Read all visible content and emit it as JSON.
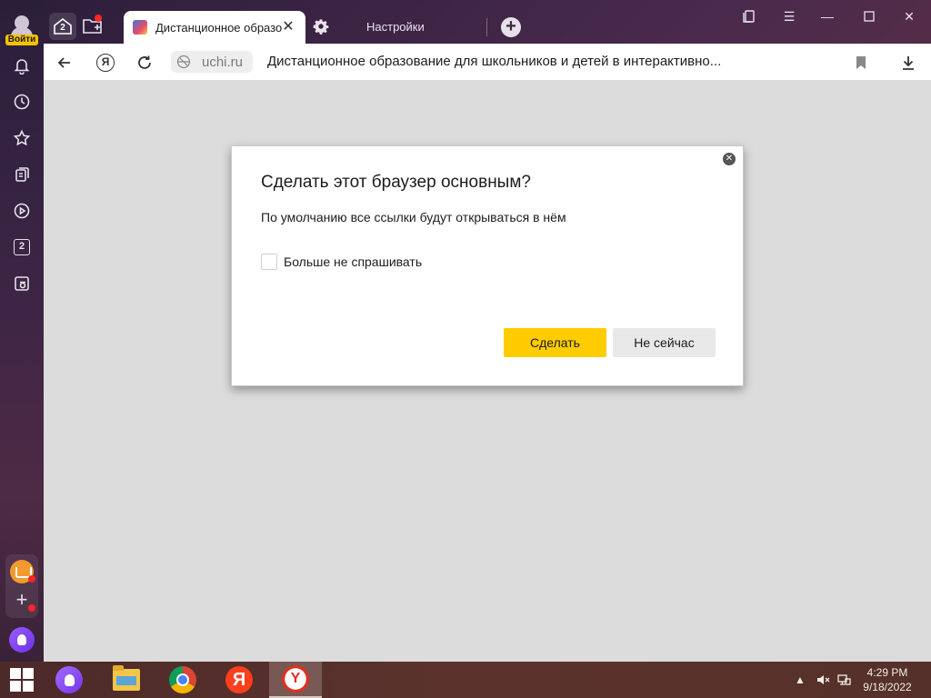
{
  "sidebar": {
    "login_label": "Войти",
    "counter_badge": "2"
  },
  "tabs": {
    "home_count": "2",
    "active_title": "Дистанционное образование для школьников",
    "settings_label": "Настройки"
  },
  "address_bar": {
    "domain": "uchi.ru",
    "page_title": "Дистанционное образование для школьников и детей в интерактивно..."
  },
  "dialog": {
    "title": "Сделать этот браузер основным?",
    "description": "По умолчанию все ссылки будут открываться в нём",
    "checkbox_label": "Больше не спрашивать",
    "checkbox_checked": false,
    "primary_button": "Сделать",
    "secondary_button": "Не сейчас"
  },
  "taskbar": {
    "time": "4:29 PM",
    "date": "9/18/2022",
    "yandex_letter": "Я"
  },
  "colors": {
    "accent_yellow": "#ffcc00",
    "content_bg": "#dcdcdc",
    "notification_red": "#ff2626"
  }
}
